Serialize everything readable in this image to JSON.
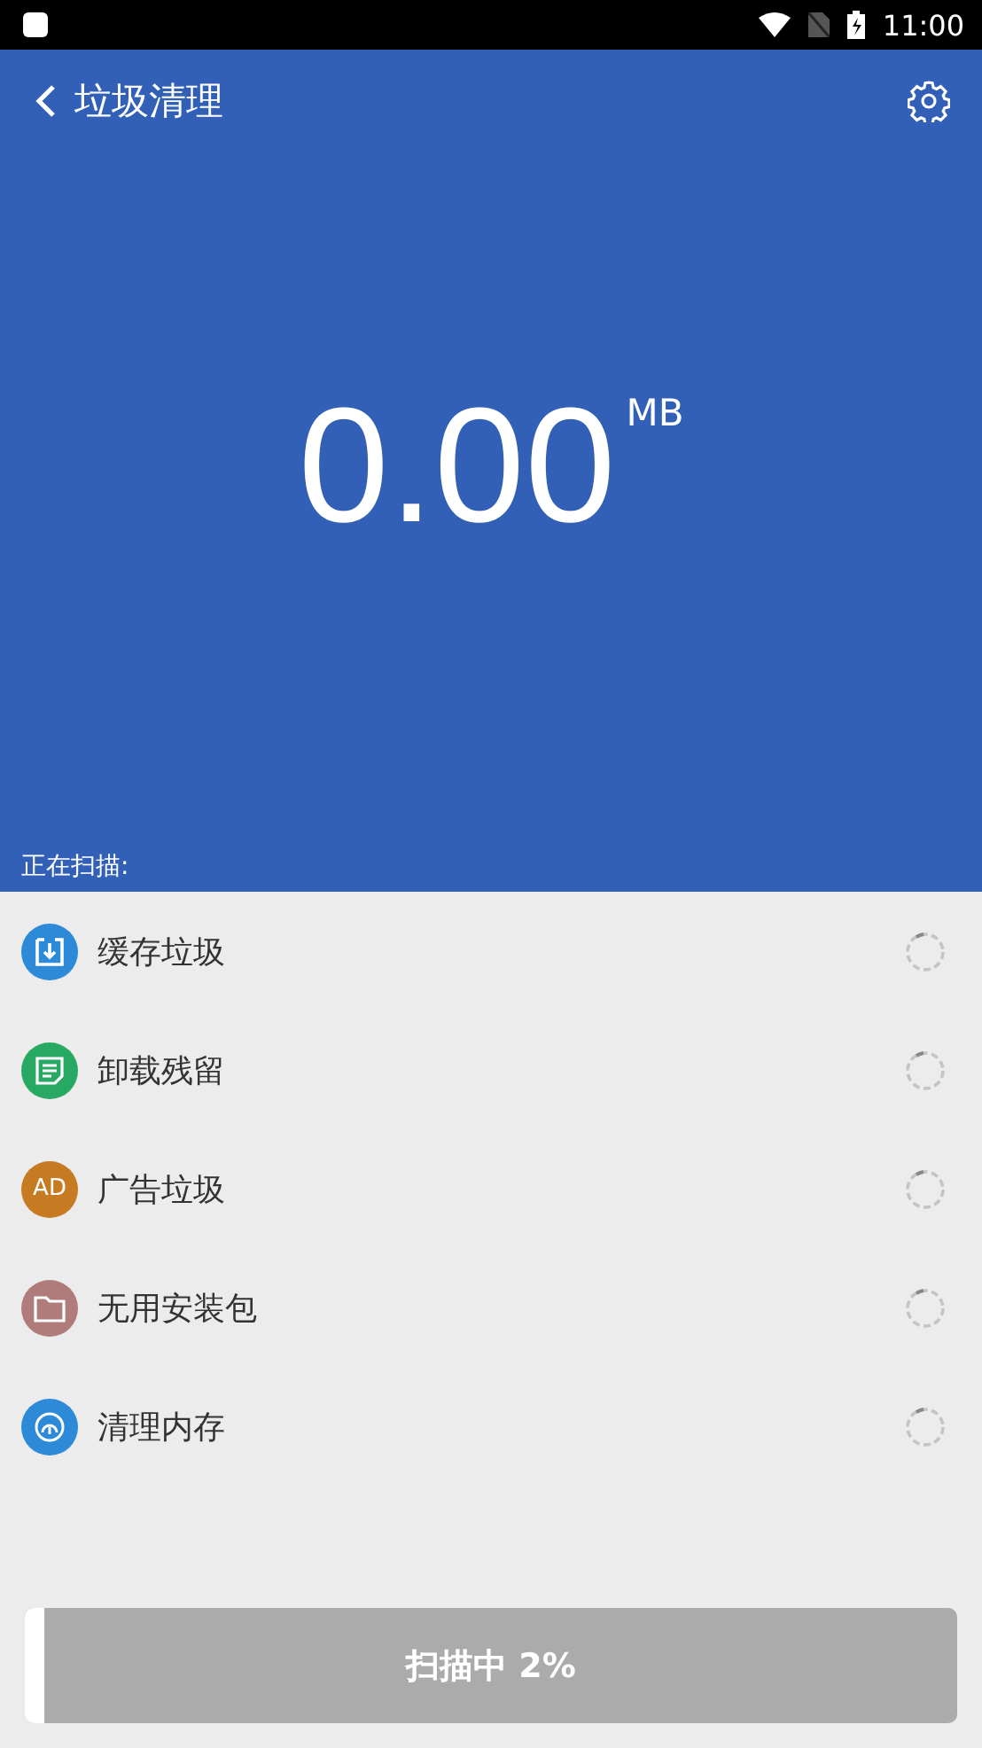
{
  "status_bar": {
    "time": "11:00"
  },
  "header": {
    "title": "垃圾清理",
    "size_value": "0.00",
    "size_unit": "MB",
    "scanning_label": "正在扫描:"
  },
  "items": [
    {
      "label": "缓存垃圾",
      "kind": "download",
      "color": "#2d8ad8"
    },
    {
      "label": "卸载残留",
      "kind": "note",
      "color": "#27a863"
    },
    {
      "label": "广告垃圾",
      "kind": "ad",
      "icon_text": "AD",
      "color": "#c67a22"
    },
    {
      "label": "无用安装包",
      "kind": "folder",
      "color": "#b07b7b"
    },
    {
      "label": "清理内存",
      "kind": "gauge",
      "color": "#2d8ad8"
    }
  ],
  "progress": {
    "label": "扫描中 2%",
    "level": 0.02
  }
}
